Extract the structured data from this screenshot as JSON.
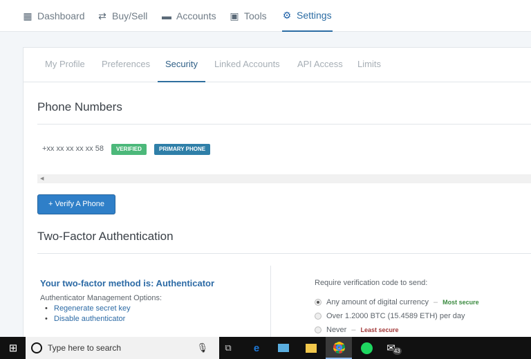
{
  "nav": {
    "items": [
      {
        "label": "Dashboard",
        "icon": "dashboard-icon"
      },
      {
        "label": "Buy/Sell",
        "icon": "exchange-icon"
      },
      {
        "label": "Accounts",
        "icon": "wallet-icon"
      },
      {
        "label": "Tools",
        "icon": "briefcase-icon"
      },
      {
        "label": "Settings",
        "icon": "gear-icon",
        "active": true
      }
    ]
  },
  "tabs": [
    "My Profile",
    "Preferences",
    "Security",
    "Linked Accounts",
    "API Access",
    "Limits"
  ],
  "active_tab": "Security",
  "phones": {
    "title": "Phone Numbers",
    "number": "+xx xx xx xx xx 58",
    "verified": "VERIFIED",
    "primary": "PRIMARY PHONE",
    "verify_button": "+ Verify A Phone"
  },
  "twofa": {
    "title": "Two-Factor Authentication",
    "method": "Your two-factor method is: Authenticator",
    "options_label": "Authenticator Management Options:",
    "options": [
      "Regenerate secret key",
      "Disable authenticator"
    ],
    "require_label": "Require verification code to send:",
    "radios": [
      {
        "label": "Any amount of digital currency",
        "note": "Most secure",
        "note_color": "#3a8a3f",
        "selected": true
      },
      {
        "label": "Over 1.2000 BTC (15.4589 ETH) per day",
        "note": "",
        "selected": false
      },
      {
        "label": "Never",
        "note": "Least secure",
        "note_color": "#a23838",
        "selected": false
      }
    ]
  },
  "colors": {
    "accent": "#2b6ca3",
    "verified": "#4cb87a",
    "primary": "#2f7fa8",
    "button": "#2f7fc8"
  },
  "taskbar": {
    "search_placeholder": "Type here to search",
    "mail_badge": "43"
  }
}
